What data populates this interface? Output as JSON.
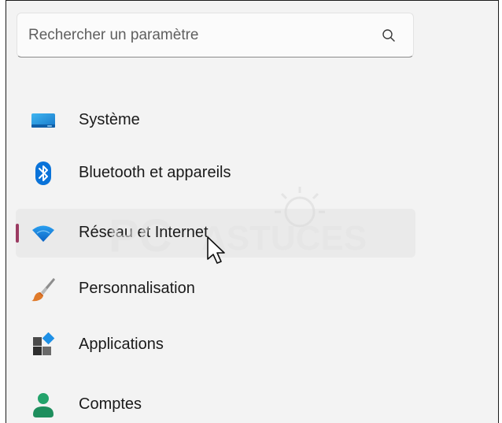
{
  "search": {
    "placeholder": "Rechercher un paramètre",
    "value": ""
  },
  "nav": {
    "items": [
      {
        "label": "Système",
        "icon": "monitor-icon"
      },
      {
        "label": "Bluetooth et appareils",
        "icon": "bluetooth-icon"
      },
      {
        "label": "Réseau et Internet",
        "icon": "wifi-icon",
        "selected": true
      },
      {
        "label": "Personnalisation",
        "icon": "paintbrush-icon"
      },
      {
        "label": "Applications",
        "icon": "apps-icon"
      },
      {
        "label": "Comptes",
        "icon": "person-icon"
      }
    ]
  },
  "watermark": {
    "text_left": "PC",
    "text_right": "ASTUCES"
  },
  "colors": {
    "accent_indicator": "#9b3b62",
    "system_icon": "#1f8fd6",
    "bluetooth_icon": "#0a73d9",
    "wifi_icon": "#1480e0",
    "person_icon": "#23a36b"
  }
}
